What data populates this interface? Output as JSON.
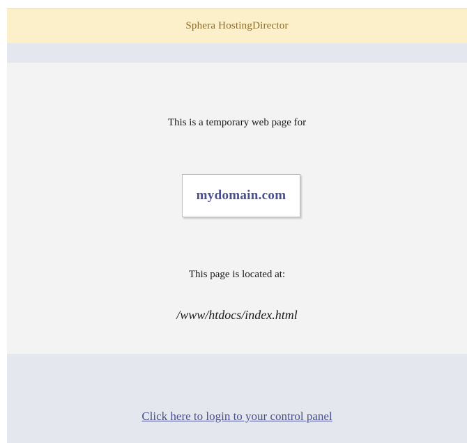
{
  "header": {
    "title": "Sphera HostingDirector"
  },
  "main": {
    "intro_text": "This is a temporary web page for",
    "domain": "mydomain.com",
    "location_label": "This page is located at:",
    "location_path": "/www/htdocs/index.html"
  },
  "footer": {
    "link_text": "Click here to login to your control panel"
  },
  "colors": {
    "header_bg": "#fbf0c9",
    "strip_bg": "#e4e8ee",
    "main_bg": "#f3f3f3",
    "accent_text": "#4a4f8c",
    "header_text": "#8a6a2a"
  }
}
